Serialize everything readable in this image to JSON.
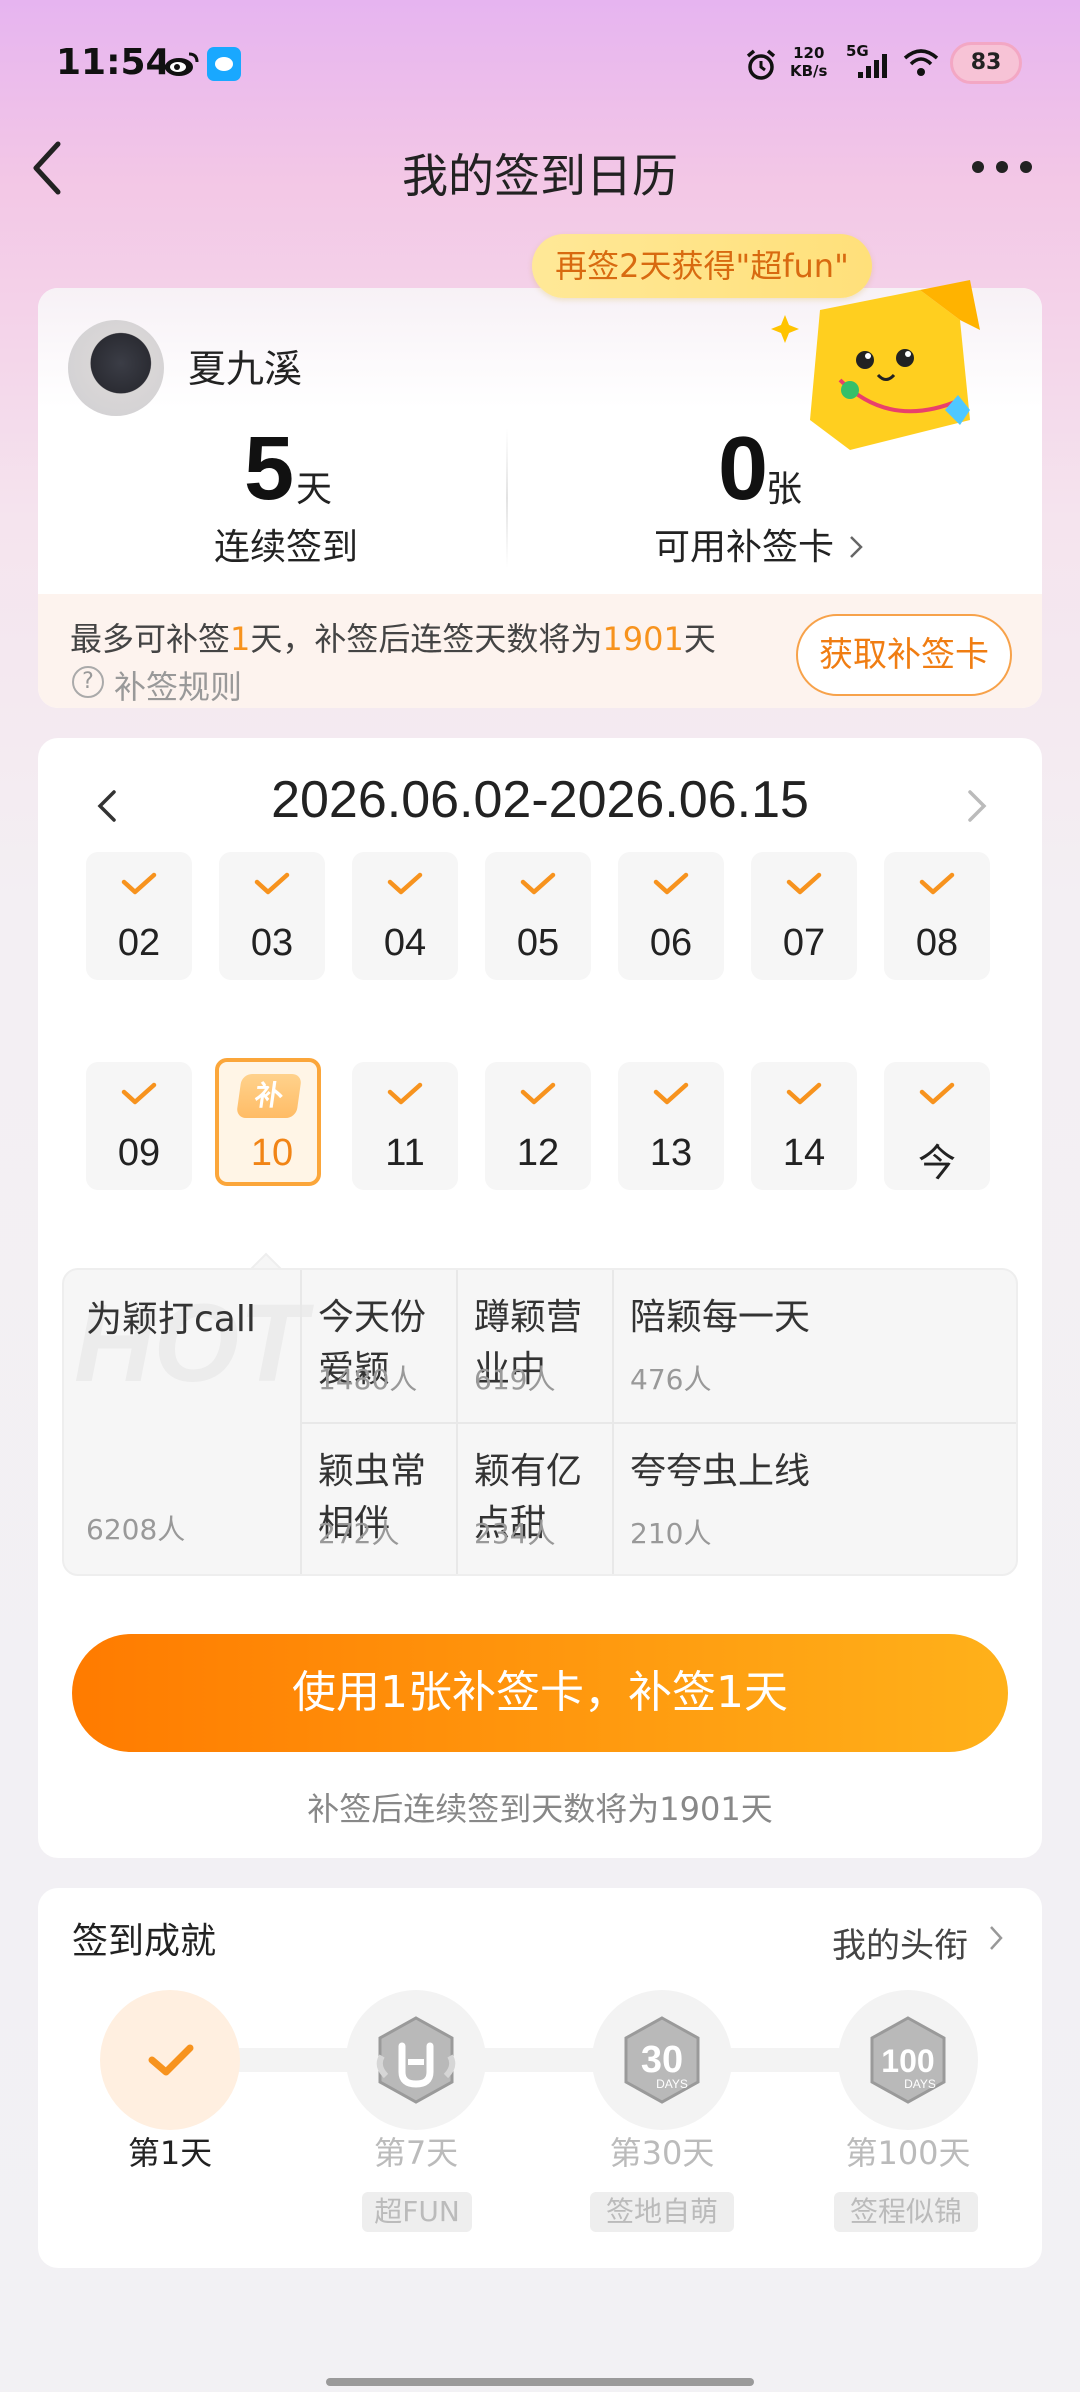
{
  "status_bar": {
    "time": "11:54",
    "net_speed_value": "120",
    "net_speed_unit": "KB/s",
    "network": "5G",
    "battery": "83"
  },
  "nav": {
    "title": "我的签到日历"
  },
  "promo": {
    "text": "再签2天获得\"超fun\""
  },
  "profile": {
    "username": "夏九溪",
    "streak_value": "5",
    "streak_unit": "天",
    "streak_label": "连续签到",
    "cards_value": "0",
    "cards_unit": "张",
    "cards_label": "可用补签卡",
    "makeup_text_1": "最多可补签",
    "makeup_days": "1",
    "makeup_text_2": "天，补签后连签天数将为",
    "makeup_total": "1901",
    "makeup_text_3": "天",
    "rules_label": "补签规则",
    "get_card_label": "获取补签卡"
  },
  "calendar": {
    "range": "2026.06.02-2026.06.15",
    "makeup_badge": "补",
    "days": [
      {
        "label": "02",
        "checked": true
      },
      {
        "label": "03",
        "checked": true
      },
      {
        "label": "04",
        "checked": true
      },
      {
        "label": "05",
        "checked": true
      },
      {
        "label": "06",
        "checked": true
      },
      {
        "label": "07",
        "checked": true
      },
      {
        "label": "08",
        "checked": true
      },
      {
        "label": "09",
        "checked": true
      },
      {
        "label": "10",
        "checked": false,
        "makeup": true
      },
      {
        "label": "11",
        "checked": true
      },
      {
        "label": "12",
        "checked": true
      },
      {
        "label": "13",
        "checked": true
      },
      {
        "label": "14",
        "checked": true
      },
      {
        "label": "今",
        "checked": true
      }
    ]
  },
  "hot": {
    "watermark": "HOT",
    "main": {
      "title": "为颖打call",
      "count": "6208人"
    },
    "items": [
      {
        "title": "今天份爱颖",
        "count": "1480人"
      },
      {
        "title": "蹲颖营业中",
        "count": "619人"
      },
      {
        "title": "陪颖每一天",
        "count": "476人"
      },
      {
        "title": "颖虫常相伴",
        "count": "272人"
      },
      {
        "title": "颖有亿点甜",
        "count": "234人"
      },
      {
        "title": "夸夸虫上线",
        "count": "210人"
      }
    ]
  },
  "action": {
    "use_card_label": "使用1张补签卡，补签1天",
    "after_note": "补签后连续签到天数将为1901天"
  },
  "achievements": {
    "title": "签到成就",
    "my_title_link": "我的头衔",
    "items": [
      {
        "label": "第1天",
        "tag": "",
        "done": true
      },
      {
        "label": "第7天",
        "tag": "超FUN",
        "done": false
      },
      {
        "label": "第30天",
        "tag": "签地自萌",
        "done": false
      },
      {
        "label": "第100天",
        "tag": "签程似锦",
        "done": false
      }
    ],
    "badge_7_text": "",
    "badge_30_text": "30",
    "badge_30_sub": "DAYS",
    "badge_100_text": "100",
    "badge_100_sub": "DAYS"
  },
  "colors": {
    "accent": "#f7931e",
    "button_gradient_start": "#ff7b00",
    "button_gradient_end": "#ffb11a"
  }
}
